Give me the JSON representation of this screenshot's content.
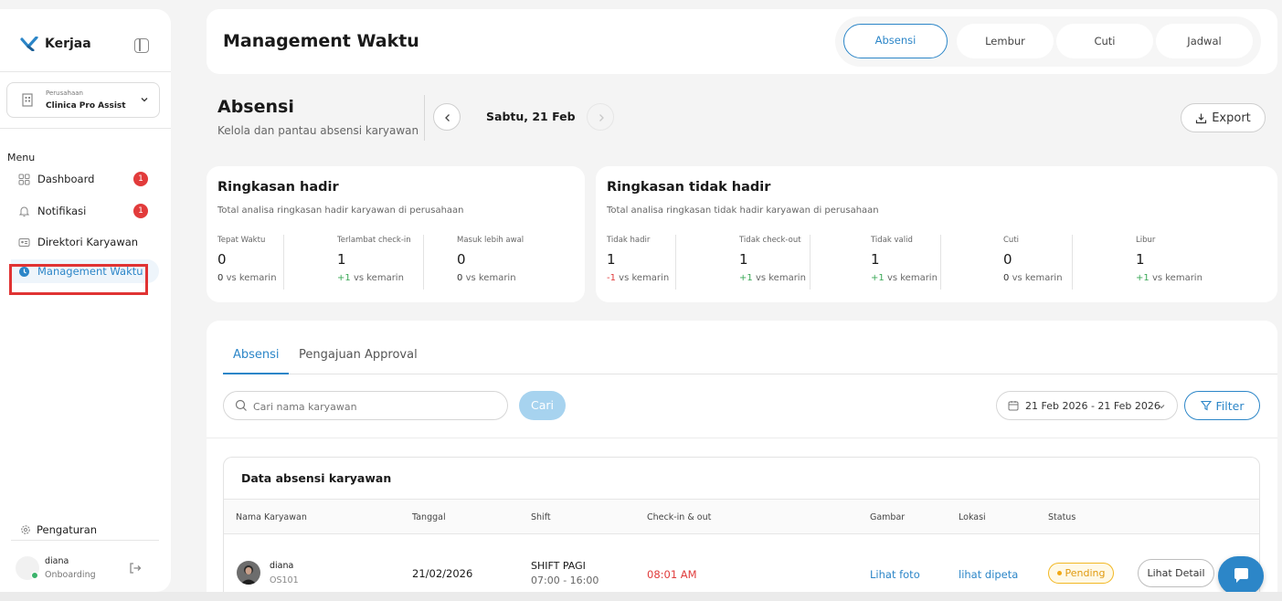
{
  "app": {
    "name": "Kerjaa",
    "brand_color": "#2c86c8",
    "highlight_color": "#e03333"
  },
  "sidebar": {
    "company_label": "Perusahaan",
    "company_name": "Clinica Pro Assist",
    "menu_label": "Menu",
    "items": [
      {
        "label": "Dashboard",
        "icon": "grid-icon",
        "badge": "1"
      },
      {
        "label": "Notifikasi",
        "icon": "bell-icon",
        "badge": "1"
      },
      {
        "label": "Direktori Karyawan",
        "icon": "id-card-icon"
      },
      {
        "label": "Management Waktu",
        "icon": "clock-icon",
        "active": true
      }
    ],
    "settings_label": "Pengaturan",
    "user": {
      "name": "diana",
      "status": "Onboarding"
    }
  },
  "header": {
    "title": "Management Waktu",
    "tabs": [
      "Absensi",
      "Lembur",
      "Cuti",
      "Jadwal"
    ],
    "active_tab": "Absensi"
  },
  "absensi": {
    "title": "Absensi",
    "subtitle": "Kelola dan pantau absensi karyawan",
    "date": "Sabtu, 21 Feb",
    "export_label": "Export"
  },
  "hadir": {
    "title": "Ringkasan hadir",
    "subtitle": "Total analisa ringkasan hadir karyawan di perusahaan",
    "stats": [
      {
        "label": "Tepat Waktu",
        "value": "0",
        "delta": "0",
        "vs": "vs kemarin"
      },
      {
        "label": "Terlambat check-in",
        "value": "1",
        "delta": "+1",
        "vs": "vs kemarin"
      },
      {
        "label": "Masuk lebih awal",
        "value": "0",
        "delta": "0",
        "vs": "vs kemarin"
      }
    ]
  },
  "tidak_hadir": {
    "title": "Ringkasan tidak hadir",
    "subtitle": "Total analisa ringkasan tidak hadir karyawan di perusahaan",
    "stats": [
      {
        "label": "Tidak hadir",
        "value": "1",
        "delta": "-1",
        "vs": "vs kemarin"
      },
      {
        "label": "Tidak check-out",
        "value": "1",
        "delta": "+1",
        "vs": "vs kemarin"
      },
      {
        "label": "Tidak valid",
        "value": "1",
        "delta": "+1",
        "vs": "vs kemarin"
      },
      {
        "label": "Cuti",
        "value": "0",
        "delta": "0",
        "vs": "vs kemarin"
      },
      {
        "label": "Libur",
        "value": "1",
        "delta": "+1",
        "vs": "vs kemarin"
      }
    ]
  },
  "panel": {
    "tabs": [
      "Absensi",
      "Pengajuan Approval"
    ],
    "search_placeholder": "Cari nama karyawan",
    "search_button": "Cari",
    "date_range": "21 Feb 2026 - 21 Feb 2026",
    "filter_label": "Filter"
  },
  "table": {
    "title": "Data absensi karyawan",
    "columns": [
      "Nama Karyawan",
      "Tanggal",
      "Shift",
      "Check-in & out",
      "Gambar",
      "Lokasi",
      "Status"
    ],
    "rows": [
      {
        "name": "diana",
        "id": "OS101",
        "date": "21/02/2026",
        "shift_name": "SHIFT PAGI",
        "shift_time": "07:00 - 16:00",
        "checkin": "08:01 AM",
        "photo_link": "Lihat foto",
        "map_link": "lihat dipeta",
        "status": "Pending",
        "action": "Lihat Detail"
      }
    ]
  }
}
